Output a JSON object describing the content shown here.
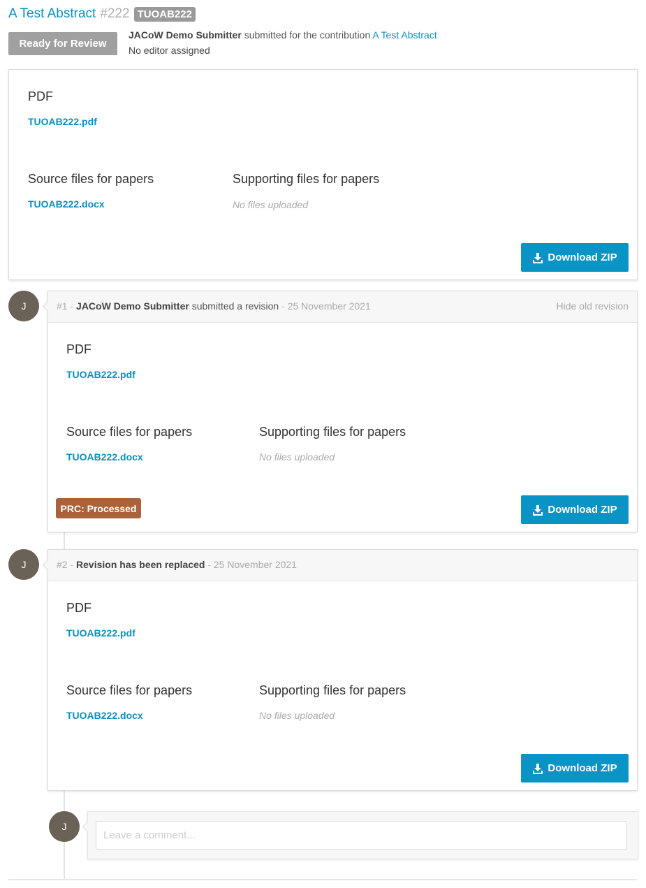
{
  "header": {
    "title": "A Test Abstract",
    "number": "#222",
    "code": "TUOAB222",
    "status": "Ready for Review",
    "submitter": "JACoW Demo Submitter",
    "submitted_text": "submitted for the contribution",
    "contribution_link": "A Test Abstract",
    "editor_text": "No editor assigned"
  },
  "current": {
    "pdf_label": "PDF",
    "pdf_file": "TUOAB222.pdf",
    "source_label": "Source files for papers",
    "source_file": "TUOAB222.docx",
    "supporting_label": "Supporting files for papers",
    "supporting_empty": "No files uploaded",
    "download_label": "Download ZIP"
  },
  "revisions": [
    {
      "avatar": "J",
      "number": "#1",
      "sep": " - ",
      "author": "JACoW Demo Submitter",
      "action": "submitted a revision",
      "date": "25 November 2021",
      "hide_label": "Hide old revision",
      "pdf_label": "PDF",
      "pdf_file": "TUOAB222.pdf",
      "source_label": "Source files for papers",
      "source_file": "TUOAB222.docx",
      "supporting_label": "Supporting files for papers",
      "supporting_empty": "No files uploaded",
      "badge": "PRC: Processed",
      "download_label": "Download ZIP"
    },
    {
      "avatar": "J",
      "number": "#2",
      "sep": " - ",
      "author": "Revision has been replaced",
      "action": "",
      "date": "25 November 2021",
      "pdf_label": "PDF",
      "pdf_file": "TUOAB222.pdf",
      "source_label": "Source files for papers",
      "source_file": "TUOAB222.docx",
      "supporting_label": "Supporting files for papers",
      "supporting_empty": "No files uploaded",
      "download_label": "Download ZIP"
    }
  ],
  "comment": {
    "avatar": "J",
    "placeholder": "Leave a comment..."
  },
  "colors": {
    "accent": "#0b8fbf",
    "download_button": "#0a94c6",
    "status_badge": "#a0a0a0",
    "prc_badge": "#a9623a",
    "avatar": "#6a6256"
  }
}
